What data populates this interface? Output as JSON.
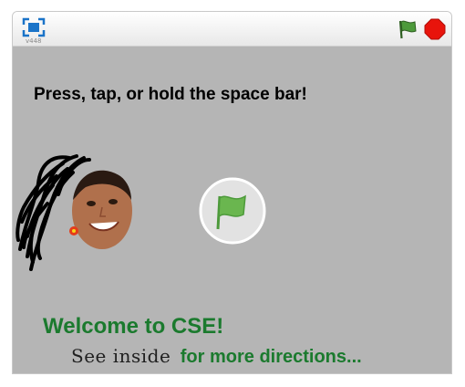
{
  "player": {
    "version": "v448",
    "icons": {
      "fullscreen": "fullscreen-icon",
      "green_flag": "green-flag-icon",
      "stop": "stop-sign-icon"
    },
    "colors": {
      "stage_bg": "#b5b5b5",
      "flag_green": "#4d9a3b",
      "stop_red": "#e8140c"
    }
  },
  "stage": {
    "instruction": "Press, tap, or hold the space bar!",
    "welcome": "Welcome to CSE!",
    "see_inside": "See inside",
    "more_directions": "for more directions...",
    "colors": {
      "welcome_text": "#1b7a2e"
    }
  }
}
